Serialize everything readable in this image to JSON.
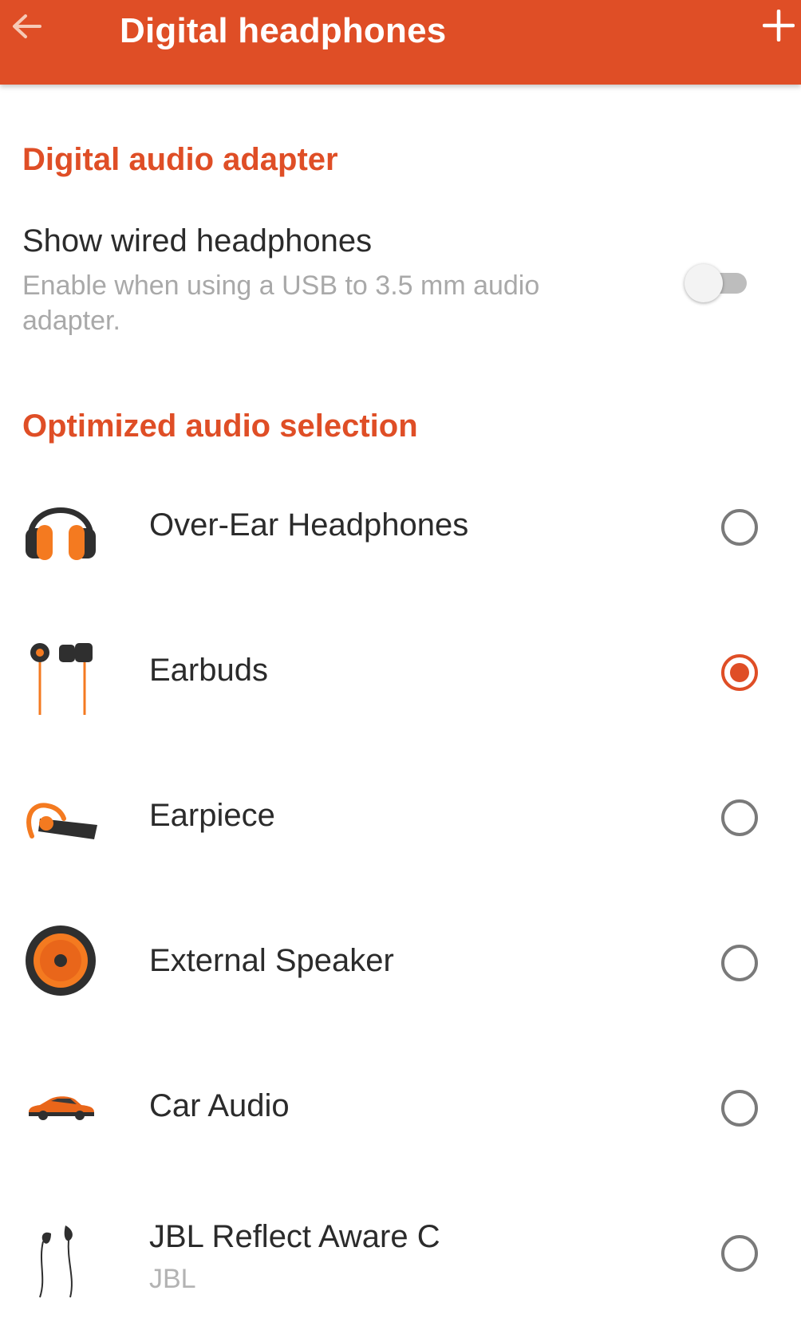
{
  "colors": {
    "accent": "#DF4E26",
    "radio_off": "#7a7a7a",
    "switch_off": "#bdbdbd"
  },
  "appbar": {
    "title": "Digital headphones",
    "back_icon": "arrow-back-icon",
    "add_icon": "plus-icon"
  },
  "digital_audio_adapter": {
    "header": "Digital audio adapter",
    "show_wired": {
      "title": "Show wired headphones",
      "summary": "Enable when using a USB to 3.5 mm audio adapter.",
      "enabled": false
    }
  },
  "optimized_audio": {
    "header": "Optimized audio selection",
    "items": [
      {
        "label": "Over-Ear Headphones",
        "icon": "over-ear-headphones-icon",
        "selected": false
      },
      {
        "label": "Earbuds",
        "icon": "earbuds-icon",
        "selected": true
      },
      {
        "label": "Earpiece",
        "icon": "earpiece-icon",
        "selected": false
      },
      {
        "label": "External Speaker",
        "icon": "speaker-icon",
        "selected": false
      },
      {
        "label": "Car Audio",
        "icon": "car-icon",
        "selected": false
      },
      {
        "label": "JBL Reflect Aware C",
        "subtitle": "JBL",
        "icon": "in-ear-headphones-icon",
        "selected": false
      }
    ]
  }
}
